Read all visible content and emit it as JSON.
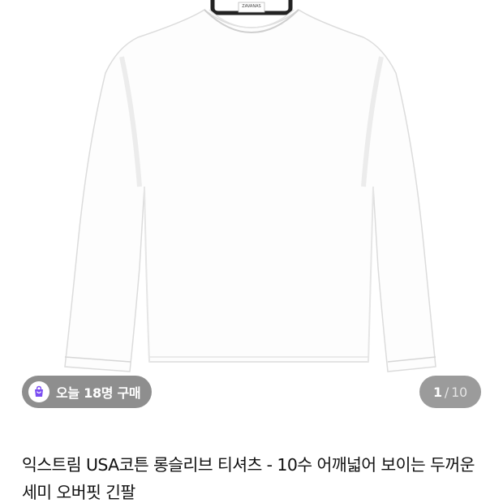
{
  "product_image": {
    "alt": "흰색 롱슬리브 티셔츠",
    "neck_label": "ZAVANAS"
  },
  "badge": {
    "icon": "shopping-bag-icon",
    "text": "오늘 18명 구매",
    "icon_color": "#7b4df2"
  },
  "gallery": {
    "current": "1",
    "separator": "/",
    "total": "10"
  },
  "product": {
    "title": "익스트림 USA코튼 롱슬리브 티셔츠 - 10수 어깨넓어 보이는 두꺼운 세미 오버핏 긴팔"
  }
}
